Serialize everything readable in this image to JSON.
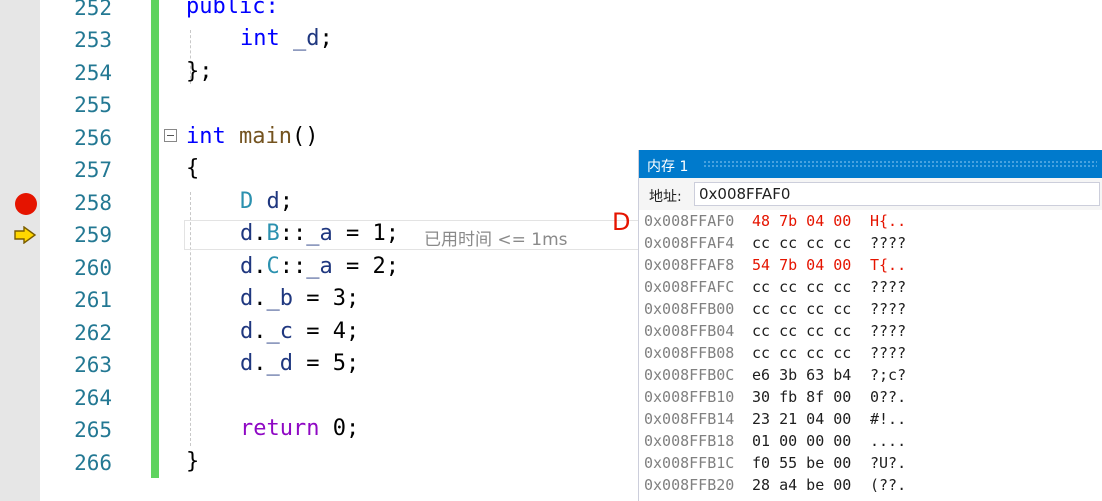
{
  "editor": {
    "lines": [
      {
        "num": "252",
        "code": "public:"
      },
      {
        "num": "253",
        "code": "int _d;"
      },
      {
        "num": "254",
        "code": "};"
      },
      {
        "num": "255",
        "code": ""
      },
      {
        "num": "256",
        "code": "int main()"
      },
      {
        "num": "257",
        "code": "{"
      },
      {
        "num": "258",
        "code": "D d;"
      },
      {
        "num": "259",
        "code": "d.B::_a = 1;"
      },
      {
        "num": "260",
        "code": "d.C::_a = 2;"
      },
      {
        "num": "261",
        "code": "d._b = 3;"
      },
      {
        "num": "262",
        "code": "d._c = 4;"
      },
      {
        "num": "263",
        "code": "d._d = 5;"
      },
      {
        "num": "264",
        "code": ""
      },
      {
        "num": "265",
        "code": "return 0;"
      },
      {
        "num": "266",
        "code": "}"
      }
    ],
    "perf_hint": "已用时间 <= 1ms",
    "cursor_label": "D",
    "breakpoint_color": "#e51400",
    "accent_color": "#007acc"
  },
  "memory": {
    "title": "内存 1",
    "address_label": "地址:",
    "address_value": "0x008FFAF0",
    "rows": [
      {
        "addr": "0x008FFAF0",
        "bytes": "48 7b 04 00",
        "chars": "H{..",
        "changed": true
      },
      {
        "addr": "0x008FFAF4",
        "bytes": "cc cc cc cc",
        "chars": "????",
        "changed": false
      },
      {
        "addr": "0x008FFAF8",
        "bytes": "54 7b 04 00",
        "chars": "T{..",
        "changed": true
      },
      {
        "addr": "0x008FFAFC",
        "bytes": "cc cc cc cc",
        "chars": "????",
        "changed": false
      },
      {
        "addr": "0x008FFB00",
        "bytes": "cc cc cc cc",
        "chars": "????",
        "changed": false
      },
      {
        "addr": "0x008FFB04",
        "bytes": "cc cc cc cc",
        "chars": "????",
        "changed": false
      },
      {
        "addr": "0x008FFB08",
        "bytes": "cc cc cc cc",
        "chars": "????",
        "changed": false
      },
      {
        "addr": "0x008FFB0C",
        "bytes": "e6 3b 63 b4",
        "chars": "?;c?",
        "changed": false
      },
      {
        "addr": "0x008FFB10",
        "bytes": "30 fb 8f 00",
        "chars": "0??.",
        "changed": false
      },
      {
        "addr": "0x008FFB14",
        "bytes": "23 21 04 00",
        "chars": "#!..",
        "changed": false
      },
      {
        "addr": "0x008FFB18",
        "bytes": "01 00 00 00",
        "chars": "....",
        "changed": false
      },
      {
        "addr": "0x008FFB1C",
        "bytes": "f0 55 be 00",
        "chars": "?U?.",
        "changed": false
      },
      {
        "addr": "0x008FFB20",
        "bytes": "28 a4 be 00",
        "chars": "(??.",
        "changed": false
      }
    ]
  }
}
